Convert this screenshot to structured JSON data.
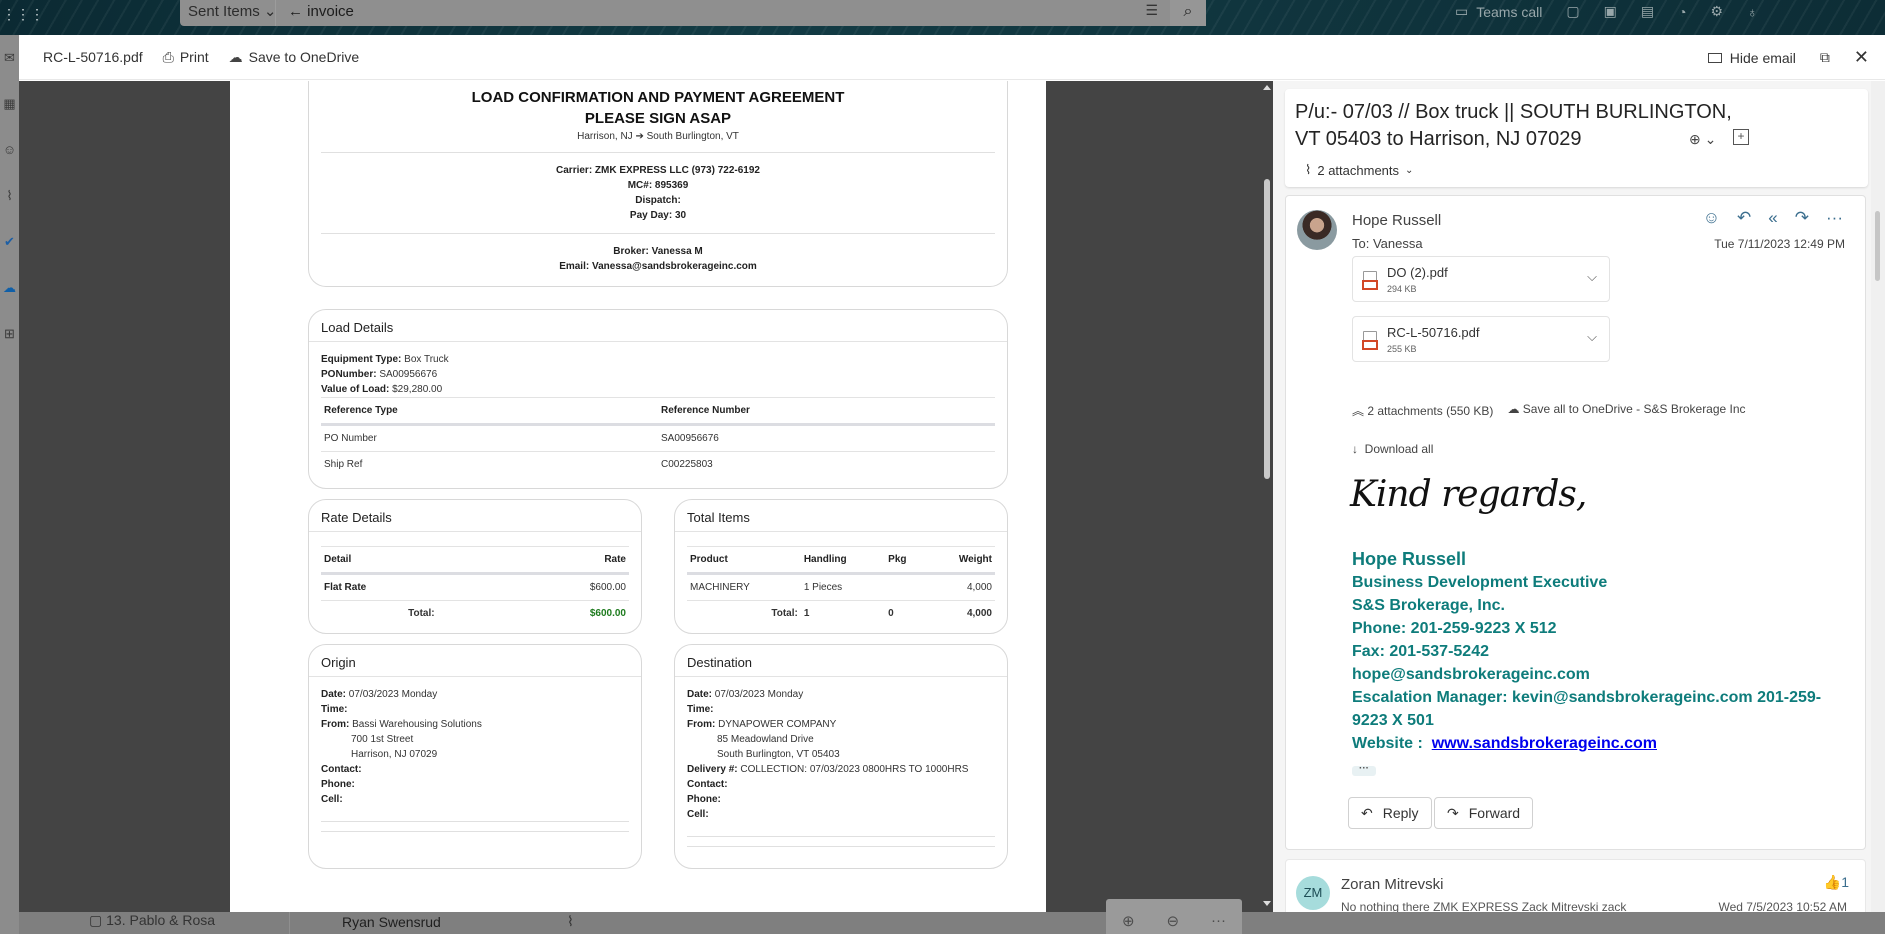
{
  "background_app": {
    "folder": "Sent Items",
    "search_query": "invoice",
    "teams_call_label": "Teams call",
    "bottom_list": {
      "folder_item": "13. Pablo & Rosa",
      "sender": "Ryan Swensrud"
    }
  },
  "viewer": {
    "file_name": "RC-L-50716.pdf",
    "print_label": "Print",
    "save_onedrive_label": "Save to OneDrive",
    "hide_email_label": "Hide email"
  },
  "pdf": {
    "title1": "LOAD CONFIRMATION AND PAYMENT AGREEMENT",
    "title2": "PLEASE SIGN ASAP",
    "route_from": "Harrison, NJ",
    "route_arrow": "➔",
    "route_to": "South Burlington, VT",
    "carrier": "Carrier:  ZMK EXPRESS LLC  (973) 722-6192",
    "mc": "MC#:  895369",
    "dispatch": "Dispatch:",
    "pay_day": "Pay Day: 30",
    "broker": "Broker: Vanessa M",
    "email": "Email: Vanessa@sandsbrokerageinc.com",
    "load_details": {
      "title": "Load Details",
      "equipment_label": "Equipment Type:",
      "equipment": "Box Truck",
      "po_label": "PONumber:",
      "po": "SA00956676",
      "value_label": "Value of Load:",
      "value": "$29,280.00",
      "columns": [
        "Reference Type",
        "Reference Number"
      ],
      "rows": [
        [
          "PO Number",
          "SA00956676"
        ],
        [
          "Ship Ref",
          "C00225803"
        ]
      ]
    },
    "rate_details": {
      "title": "Rate Details",
      "columns": [
        "Detail",
        "Rate"
      ],
      "rows": [
        [
          "Flat Rate",
          "$600.00"
        ]
      ],
      "total_label": "Total:",
      "total": "$600.00"
    },
    "total_items": {
      "title": "Total Items",
      "columns": [
        "Product",
        "Handling",
        "Pkg",
        "Weight"
      ],
      "rows": [
        [
          "MACHINERY",
          "1 Pieces",
          "",
          "4,000"
        ]
      ],
      "total_label": "Total:",
      "total_handling": "1",
      "total_pkg": "0",
      "total_weight": "4,000"
    },
    "origin": {
      "title": "Origin",
      "date_label": "Date:",
      "date": "07/03/2023 Monday",
      "time_label": "Time:",
      "from_label": "From:",
      "from": "Bassi Warehousing Solutions",
      "addr1": "700 1st Street",
      "addr2": "Harrison, NJ 07029",
      "contact_label": "Contact:",
      "phone_label": "Phone:",
      "cell_label": "Cell:"
    },
    "destination": {
      "title": "Destination",
      "date_label": "Date:",
      "date": "07/03/2023 Monday",
      "time_label": "Time:",
      "from_label": "From:",
      "from": "DYNAPOWER COMPANY",
      "addr1": "85 Meadowland Drive",
      "addr2": "South Burlington, VT 05403",
      "delivery_label": "Delivery #:",
      "delivery": "COLLECTION: 07/03/2023 0800HRS TO 1000HRS",
      "contact_label": "Contact:",
      "phone_label": "Phone:",
      "cell_label": "Cell:"
    }
  },
  "email": {
    "subject": "P/u:- 07/03 // Box truck || SOUTH BURLINGTON, VT 05403 to Harrison, NJ 07029",
    "attachments_summary": "2 attachments",
    "message": {
      "from": "Hope Russell",
      "to": "To:  Vanessa",
      "date": "Tue 7/11/2023 12:49 PM",
      "attachments": [
        {
          "name": "DO (2).pdf",
          "size": "294 KB"
        },
        {
          "name": "RC-L-50716.pdf",
          "size": "255 KB"
        }
      ],
      "attach_total": "2 attachments (550 KB)",
      "save_all": "Save all to OneDrive - S&S Brokerage Inc",
      "download_all": "Download all",
      "closing": "Kind regards,",
      "signature": {
        "name": "Hope Russell",
        "title": "Business Development Executive",
        "company": "S&S Brokerage, Inc.",
        "phone": "Phone: 201-259-9223 X 512",
        "fax": "Fax: 201-537-5242",
        "email": "hope@sandsbrokerageinc.com",
        "escalation": "Escalation Manager: kevin@sandsbrokerageinc.com 201-259-9223 X 501",
        "website_label": "Website :",
        "website": "www.sandsbrokerageinc.com"
      },
      "reply_label": "Reply",
      "forward_label": "Forward"
    },
    "message2": {
      "initials": "ZM",
      "from": "Zoran Mitrevski",
      "preview": "No nothing there ZMK EXPRESS Zack Mitrevski zack",
      "date": "Wed 7/5/2023 10:52 AM",
      "like_count": "1"
    }
  },
  "colors": {
    "signature": "#0e7c7b",
    "link": "#0000ee",
    "total_green": "#1e7b1e",
    "pdf_icon": "#d24726"
  }
}
